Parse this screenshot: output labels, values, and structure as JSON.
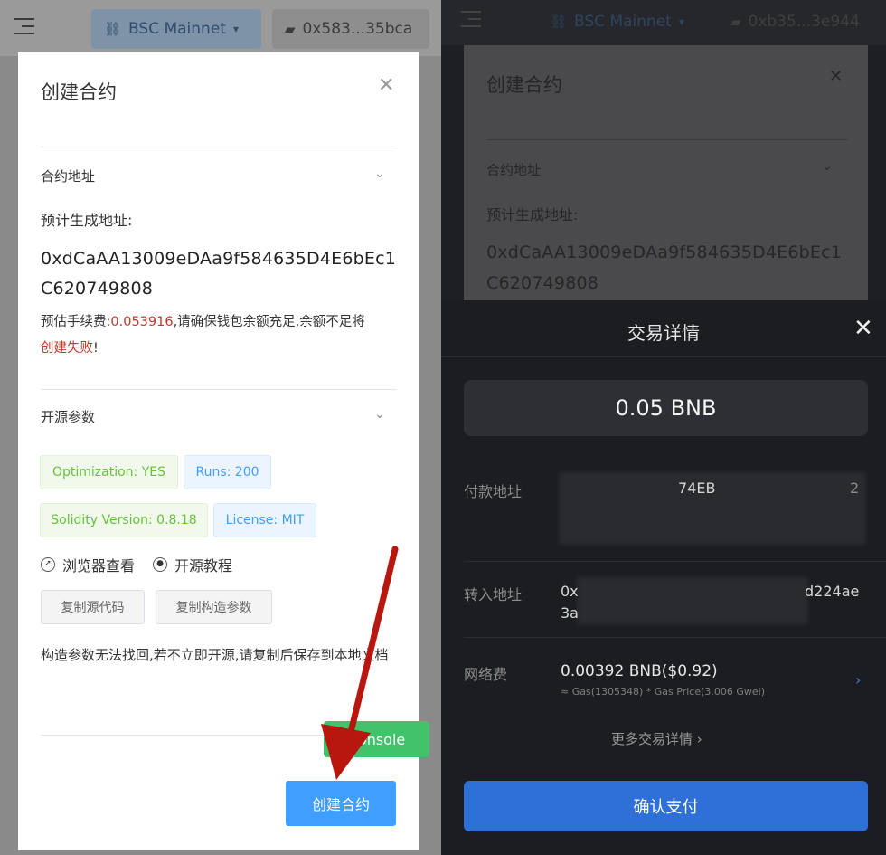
{
  "left": {
    "network_label": "BSC Mainnet",
    "account_label": "0x583...35bca",
    "modal": {
      "title": "创建合约",
      "contract_section_title": "合约地址",
      "expected_address_label": "预计生成地址:",
      "address": "0xdCaAA13009eDAa9f584635D4E6bEc1C620749808",
      "fee_prefix": "预估手续费:",
      "fee_value": "0.053916",
      "fee_middle": ",请确保钱包余额充足,余额不足将",
      "fee_fail": "创建失败",
      "fee_suffix": "!",
      "opensource_section_title": "开源参数",
      "tags": {
        "optimization": "Optimization: YES",
        "runs": "Runs: 200",
        "solidity": "Solidity Version: 0.8.18",
        "license": "License: MIT"
      },
      "browser_link": "浏览器查看",
      "tutorial_link": "开源教程",
      "copy_source_button": "复制源代码",
      "copy_args_button": "复制构造参数",
      "warning": "构造参数无法找回,若不立即开源,请复制后保存到本地文档",
      "create_button": "创建合约"
    },
    "console_button": "Console"
  },
  "right": {
    "network_label": "BSC Mainnet",
    "account_label": "0xb35...3e944",
    "ghost": {
      "title": "创建合约",
      "contract_section_title": "合约地址",
      "expected_address_label": "预计生成地址:",
      "address": "0xdCaAA13009eDAa9f584635D4E6bEc1C620749808"
    },
    "sheet": {
      "title": "交易详情",
      "amount": "0.05 BNB",
      "from_label": "付款地址",
      "from_value_visible": "74EB",
      "from_value_end": "2",
      "to_label": "转入地址",
      "to_value_start": "0x",
      "to_value_end": "d224ae",
      "to_value_line2": "3a",
      "fee_label": "网络费",
      "fee_value": "0.00392 BNB($0.92)",
      "fee_detail": "≈ Gas(1305348) * Gas Price(3.006 Gwei)",
      "more_details": "更多交易详情",
      "confirm_button": "确认支付"
    }
  },
  "colors": {
    "primary_blue": "#409eff",
    "error_red": "#c0392b",
    "console_green": "#42c26b",
    "confirm_blue": "#2f6fd8",
    "annotation_arrow": "#b8170f"
  }
}
